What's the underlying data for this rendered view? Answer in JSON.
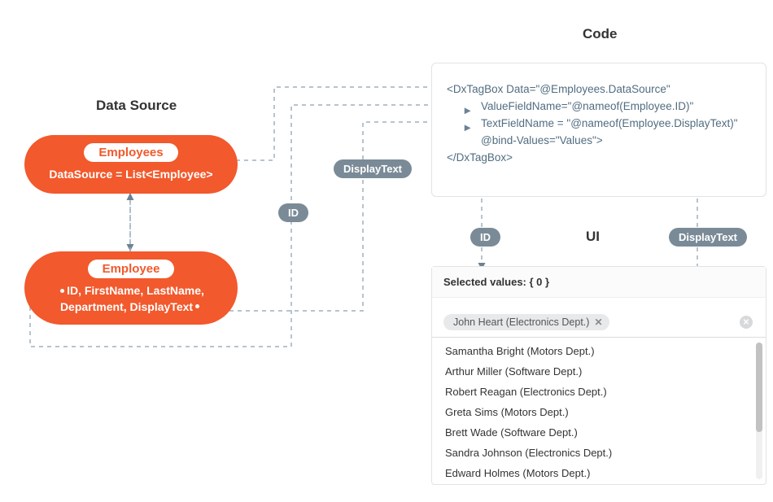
{
  "sections": {
    "dataSource": "Data Source",
    "code": "Code",
    "ui": "UI"
  },
  "blobs": {
    "employees": {
      "title": "Employees",
      "subtitle": "DataSource = List<Employee>"
    },
    "employee": {
      "title": "Employee",
      "line1": "ID, FirstName, LastName,",
      "line2": "Department, DisplayText"
    }
  },
  "badges": {
    "id_ds": "ID",
    "displayText_ds": "DisplayText",
    "id_ui": "ID",
    "displayText_ui": "DisplayText"
  },
  "code": {
    "l1": "<DxTagBox Data=\"@Employees.DataSource\"",
    "l2": "ValueFieldName=\"@nameof(Employee.ID)\"",
    "l3": "TextFieldName = \"@nameof(Employee.DisplayText)\"",
    "l4": "@bind-Values=\"Values\">",
    "l5": "</DxTagBox>"
  },
  "ui": {
    "selected_label": "Selected values: { 0 }",
    "tag": "John Heart (Electronics Dept.)",
    "dropdown": [
      "Samantha Bright (Motors Dept.)",
      "Arthur Miller (Software Dept.)",
      "Robert Reagan (Electronics Dept.)",
      "Greta Sims (Motors Dept.)",
      "Brett Wade (Software Dept.)",
      "Sandra Johnson (Electronics Dept.)",
      "Edward Holmes (Motors Dept.)"
    ]
  }
}
